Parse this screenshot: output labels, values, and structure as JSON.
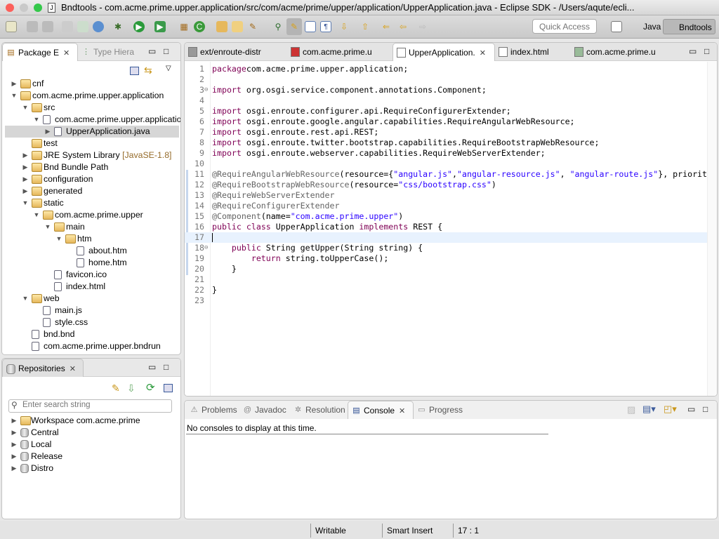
{
  "window": {
    "title": "Bndtools - com.acme.prime.upper.application/src/com/acme/prime/upper/application/UpperApplication.java - Eclipse SDK - /Users/aqute/ecli..."
  },
  "toolbar": {
    "quick_access_placeholder": "Quick Access",
    "perspectives": [
      {
        "label": "Java",
        "active": false
      },
      {
        "label": "Bndtools",
        "active": true
      }
    ]
  },
  "explorer": {
    "tabs": [
      {
        "label": "Package E",
        "active": true
      },
      {
        "label": "Type Hiera",
        "active": false
      }
    ],
    "tree": [
      {
        "label": "cnf",
        "level": 0,
        "expanded": false,
        "icon": "project-folder"
      },
      {
        "label": "com.acme.prime.upper.application",
        "level": 0,
        "expanded": true,
        "icon": "project-folder"
      },
      {
        "label": "src",
        "level": 1,
        "expanded": true,
        "icon": "source-folder"
      },
      {
        "label": "com.acme.prime.upper.applicatio",
        "level": 2,
        "expanded": true,
        "icon": "package"
      },
      {
        "label": "UpperApplication.java",
        "level": 3,
        "expanded": false,
        "icon": "java-file",
        "selected": true
      },
      {
        "label": "test",
        "level": 1,
        "expanded": null,
        "icon": "source-folder"
      },
      {
        "label": "JRE System Library",
        "suffix": "[JavaSE-1.8]",
        "level": 1,
        "expanded": false,
        "icon": "library"
      },
      {
        "label": "Bnd Bundle Path",
        "level": 1,
        "expanded": false,
        "icon": "library"
      },
      {
        "label": "configuration",
        "level": 1,
        "expanded": false,
        "icon": "folder"
      },
      {
        "label": "generated",
        "level": 1,
        "expanded": false,
        "icon": "folder"
      },
      {
        "label": "static",
        "level": 1,
        "expanded": true,
        "icon": "folder"
      },
      {
        "label": "com.acme.prime.upper",
        "level": 2,
        "expanded": true,
        "icon": "folder"
      },
      {
        "label": "main",
        "level": 3,
        "expanded": true,
        "icon": "folder"
      },
      {
        "label": "htm",
        "level": 4,
        "expanded": true,
        "icon": "folder"
      },
      {
        "label": "about.htm",
        "level": 5,
        "expanded": null,
        "icon": "html-file"
      },
      {
        "label": "home.htm",
        "level": 5,
        "expanded": null,
        "icon": "html-file"
      },
      {
        "label": "favicon.ico",
        "level": 3,
        "expanded": null,
        "icon": "file"
      },
      {
        "label": "index.html",
        "level": 3,
        "expanded": null,
        "icon": "html-file"
      },
      {
        "label": "web",
        "level": 1,
        "expanded": true,
        "icon": "folder"
      },
      {
        "label": "main.js",
        "level": 2,
        "expanded": null,
        "icon": "js-file"
      },
      {
        "label": "style.css",
        "level": 2,
        "expanded": null,
        "icon": "css-file"
      },
      {
        "label": "bnd.bnd",
        "level": 1,
        "expanded": null,
        "icon": "bnd-file"
      },
      {
        "label": "com.acme.prime.upper.bndrun",
        "level": 1,
        "expanded": null,
        "icon": "bndrun-file"
      }
    ]
  },
  "repositories": {
    "tab": "Repositories",
    "search_placeholder": "Enter search string",
    "items": [
      {
        "label": "Workspace com.acme.prime",
        "icon": "project-folder"
      },
      {
        "label": "Central",
        "icon": "database"
      },
      {
        "label": "Local",
        "icon": "database"
      },
      {
        "label": "Release",
        "icon": "database"
      },
      {
        "label": "Distro",
        "icon": "remote-database"
      }
    ]
  },
  "editor": {
    "tabs": [
      {
        "label": "ext/enroute-distr",
        "icon": "repo",
        "active": false
      },
      {
        "label": "com.acme.prime.u",
        "icon": "bnd",
        "active": false
      },
      {
        "label": "UpperApplication.",
        "icon": "java",
        "active": true
      },
      {
        "label": "index.html",
        "icon": "html",
        "active": false
      },
      {
        "label": "com.acme.prime.u",
        "icon": "bndrun",
        "active": false
      }
    ],
    "current_line": 17,
    "lines": [
      [
        [
          "kw",
          "package"
        ],
        [
          "",
          "com.acme.prime.upper.application;"
        ]
      ],
      [],
      [
        [
          "kw",
          "import"
        ],
        [
          "",
          " org.osgi.service.component.annotations.Component;"
        ]
      ],
      [],
      [
        [
          "kw",
          "import"
        ],
        [
          "",
          " osgi.enroute.configurer.api.RequireConfigurerExtender;"
        ]
      ],
      [
        [
          "kw",
          "import"
        ],
        [
          "",
          " osgi.enroute.google.angular.capabilities.RequireAngularWebResource;"
        ]
      ],
      [
        [
          "kw",
          "import"
        ],
        [
          "",
          " osgi.enroute.rest.api.REST;"
        ]
      ],
      [
        [
          "kw",
          "import"
        ],
        [
          "",
          " osgi.enroute.twitter.bootstrap.capabilities.RequireBootstrapWebResource;"
        ]
      ],
      [
        [
          "kw",
          "import"
        ],
        [
          "",
          " osgi.enroute.webserver.capabilities.RequireWebServerExtender;"
        ]
      ],
      [],
      [
        [
          "ann",
          "@RequireAngularWebResource"
        ],
        [
          "",
          "(resource={"
        ],
        [
          "str",
          "\"angular.js\""
        ],
        [
          "",
          ","
        ],
        [
          "str",
          "\"angular-resource.js\""
        ],
        [
          "",
          ", "
        ],
        [
          "str",
          "\"angular-route.js\""
        ],
        [
          "",
          "}, priorit"
        ]
      ],
      [
        [
          "ann",
          "@RequireBootstrapWebResource"
        ],
        [
          "",
          "(resource="
        ],
        [
          "str",
          "\"css/bootstrap.css\""
        ],
        [
          "",
          ")"
        ]
      ],
      [
        [
          "ann",
          "@RequireWebServerExtender"
        ]
      ],
      [
        [
          "ann",
          "@RequireConfigurerExtender"
        ]
      ],
      [
        [
          "ann",
          "@Component"
        ],
        [
          "",
          "(name="
        ],
        [
          "str",
          "\"com.acme.prime.upper\""
        ],
        [
          "",
          ")"
        ]
      ],
      [
        [
          "kw",
          "public"
        ],
        [
          "",
          " "
        ],
        [
          "kw",
          "class"
        ],
        [
          "",
          " UpperApplication "
        ],
        [
          "kw",
          "implements"
        ],
        [
          "",
          " REST {"
        ]
      ],
      [],
      [
        [
          "",
          "    "
        ],
        [
          "kw",
          "public"
        ],
        [
          "",
          " String getUpper(String string) {"
        ]
      ],
      [
        [
          "",
          "        "
        ],
        [
          "kw",
          "return"
        ],
        [
          "",
          " string.toUpperCase();"
        ]
      ],
      [
        [
          "",
          "    }"
        ]
      ],
      [],
      [
        [
          "",
          "}"
        ]
      ],
      []
    ]
  },
  "bottom": {
    "tabs": [
      {
        "label": "Problems",
        "active": false
      },
      {
        "label": "Javadoc",
        "active": false
      },
      {
        "label": "Resolution",
        "active": false
      },
      {
        "label": "Console",
        "active": true
      },
      {
        "label": "Progress",
        "active": false
      }
    ],
    "console_message": "No consoles to display at this time."
  },
  "status": {
    "writable": "Writable",
    "insert_mode": "Smart Insert",
    "position": "17 : 1"
  }
}
